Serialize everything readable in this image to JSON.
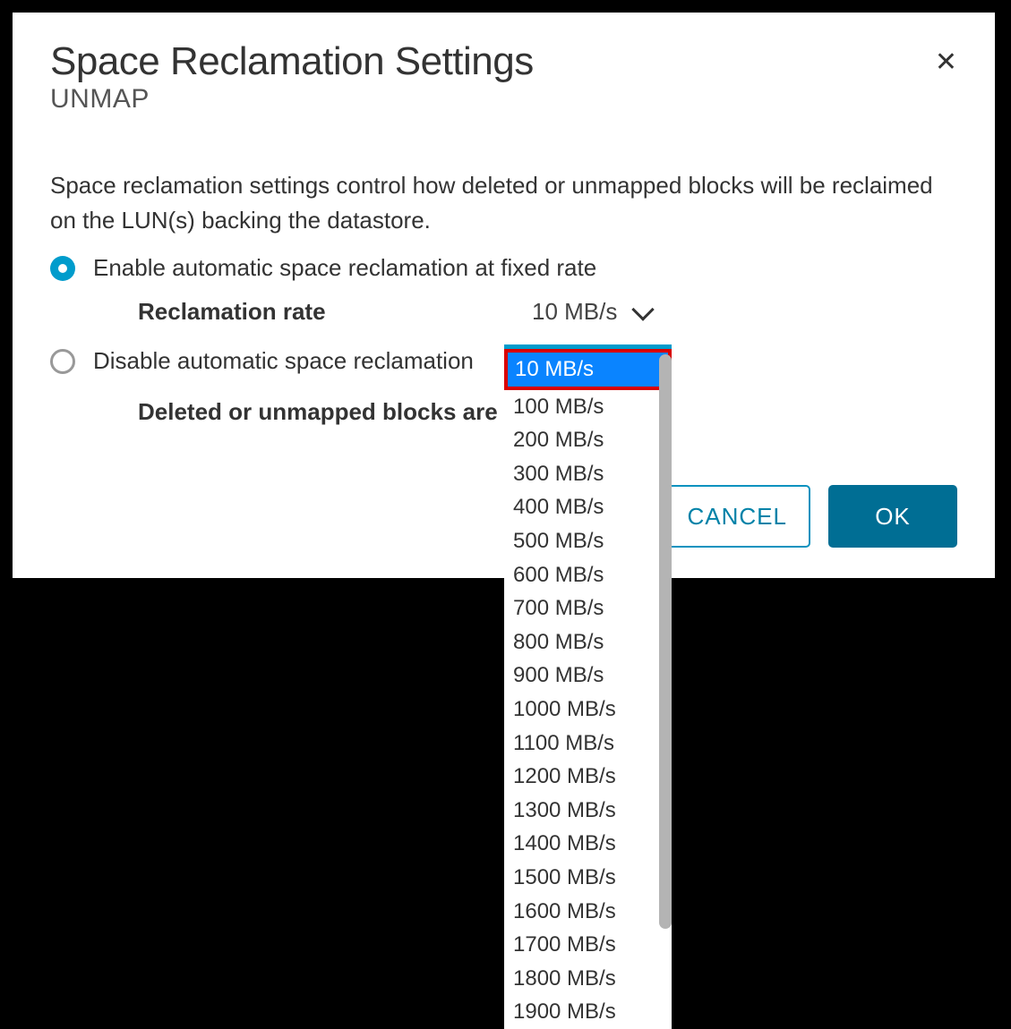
{
  "dialog": {
    "title": "Space Reclamation Settings",
    "subtitle": "UNMAP",
    "description": "Space reclamation settings control how deleted or unmapped blocks will be reclaimed on the LUN(s) backing the datastore."
  },
  "options": {
    "enable_label": "Enable automatic space reclamation at fixed rate",
    "disable_label": "Disable automatic space reclamation",
    "rate_label": "Reclamation rate",
    "deleted_blocks_label_partial": "Deleted or unmapped blocks are "
  },
  "dropdown": {
    "selected_display": "10 MB/s",
    "selected_value": "10 MB/s",
    "options": [
      "10 MB/s",
      "100 MB/s",
      "200 MB/s",
      "300 MB/s",
      "400 MB/s",
      "500 MB/s",
      "600 MB/s",
      "700 MB/s",
      "800 MB/s",
      "900 MB/s",
      "1000 MB/s",
      "1100 MB/s",
      "1200 MB/s",
      "1300 MB/s",
      "1400 MB/s",
      "1500 MB/s",
      "1600 MB/s",
      "1700 MB/s",
      "1800 MB/s",
      "1900 MB/s"
    ]
  },
  "buttons": {
    "cancel": "CANCEL",
    "ok": "OK"
  }
}
